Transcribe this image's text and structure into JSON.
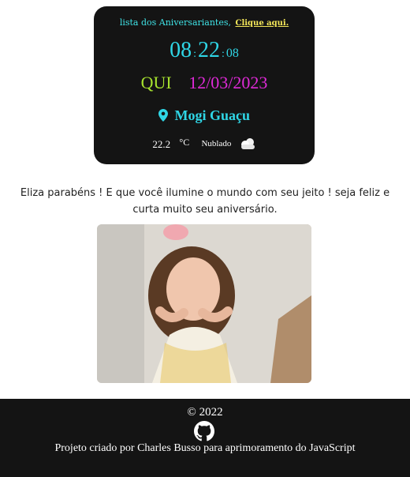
{
  "clock": {
    "list_text": "lista dos Aniversariantes,",
    "link_text": "Clique aqui.",
    "hours": "08",
    "minutes": "22",
    "seconds": "08",
    "sep": ":",
    "weekday": "QUI",
    "date": "12/03/2023",
    "city": "Mogi Guaçu",
    "temperature": "22.2",
    "unit": "°C",
    "condition": "Nublado",
    "icons": {
      "location": "map-pin-icon",
      "weather": "cloudy-icon"
    },
    "colors": {
      "cyan": "#2fd6e6",
      "green": "#a6e22e",
      "magenta": "#e02ad8",
      "link": "#f5e85a"
    }
  },
  "message": "Eliza parabéns ! E que você ilumine o mundo com seu jeito ! seja feliz e curta muito seu aniversário.",
  "footer": {
    "copyright": "© 2022",
    "credit": "Projeto criado por Charles Busso para aprimoramento do JavaScript",
    "icon": "github-icon"
  }
}
